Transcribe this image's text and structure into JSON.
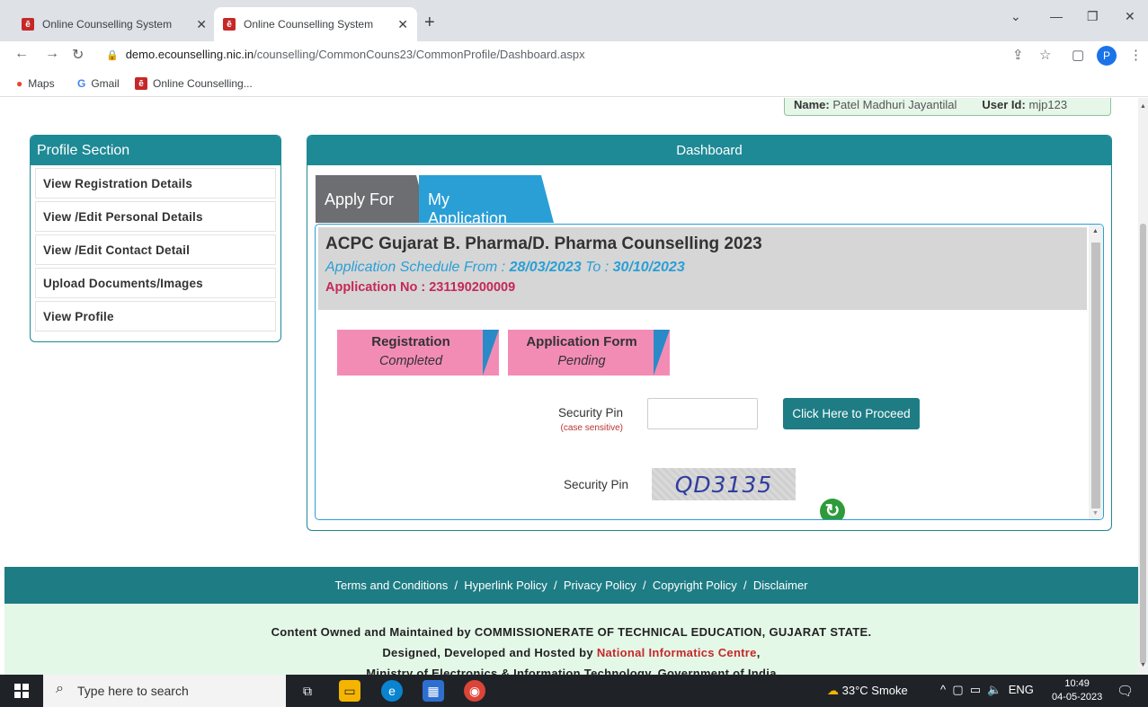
{
  "browser": {
    "tabs": [
      {
        "title": "Online Counselling System",
        "active": false
      },
      {
        "title": "Online Counselling System",
        "active": true
      }
    ],
    "url_host": "demo.ecounselling.nic.in",
    "url_path": "/counselling/CommonCouns23/CommonProfile/Dashboard.aspx",
    "avatar_letter": "P",
    "bookmarks": [
      "Maps",
      "Gmail",
      "Online Counselling..."
    ]
  },
  "user": {
    "name_label": "Name:",
    "name_value": "Patel Madhuri Jayantilal",
    "id_label": "User Id:",
    "id_value": "mjp123"
  },
  "profile": {
    "title": "Profile Section",
    "links": [
      "View Registration Details",
      "View /Edit Personal Details",
      "View /Edit Contact Detail",
      "Upload Documents/Images",
      "View Profile"
    ]
  },
  "dashboard": {
    "title": "Dashboard",
    "tabs": [
      "Apply For",
      "My Application"
    ],
    "application": {
      "title": "ACPC Gujarat B. Pharma/D. Pharma Counselling 2023",
      "schedule_prefix": "Application Schedule From :",
      "schedule_from": "28/03/2023",
      "schedule_to_label": "To :",
      "schedule_to": "30/10/2023",
      "appno_label": "Application No :",
      "appno": "231190200009"
    },
    "steps": [
      {
        "title": "Registration",
        "status": "Completed"
      },
      {
        "title": "Application Form",
        "status": "Pending"
      }
    ],
    "pin_label": "Security Pin",
    "pin_note": "(case sensitive)",
    "proceed_label": "Click Here to Proceed",
    "captcha_label": "Security Pin",
    "captcha_text": "QD3135"
  },
  "footer": {
    "links": [
      "Terms and Conditions",
      "Hyperlink Policy",
      "Privacy Policy",
      "Copyright Policy",
      "Disclaimer"
    ],
    "line1": "Content Owned and Maintained by COMMISSIONERATE OF TECHNICAL EDUCATION, GUJARAT STATE.",
    "line2_prefix": "Designed, Developed and Hosted by",
    "line2_nic": "National Informatics Centre",
    "line2_suffix": ",",
    "line3": "Ministry of Electronics & Information Technology, Government of India"
  },
  "taskbar": {
    "search_placeholder": "Type here to search",
    "weather": "33°C  Smoke",
    "lang": "ENG",
    "time": "10:49",
    "date": "04-05-2023"
  }
}
